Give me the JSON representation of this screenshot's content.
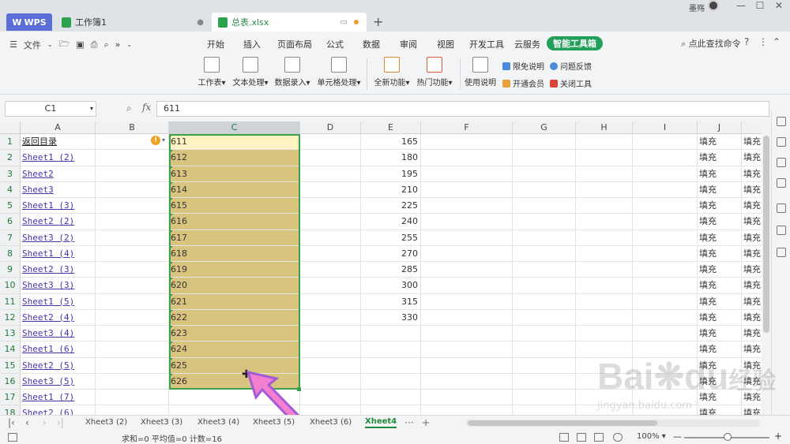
{
  "titlebar": {
    "tabs": [
      {
        "label": "WPS"
      },
      {
        "label": "工作簿1"
      },
      {
        "label": "总表.xlsx"
      }
    ],
    "user": "墨殇"
  },
  "menubar": {
    "file": "文件",
    "items": [
      "开始",
      "插入",
      "页面布局",
      "公式",
      "数据",
      "审阅",
      "视图",
      "开发工具",
      "云服务",
      "智能工具箱"
    ],
    "search": "点此查找命令"
  },
  "ribbon": {
    "buttons": [
      "工作表",
      "文本处理",
      "数据录入",
      "单元格处理",
      "全新功能",
      "热门功能",
      "使用说明"
    ],
    "small": [
      "限免说明",
      "问题反馈",
      "开通会员",
      "关闭工具"
    ]
  },
  "formula": {
    "namebox": "C1",
    "fx": "fx",
    "value": "611"
  },
  "grid": {
    "columns": [
      "A",
      "B",
      "C",
      "D",
      "E",
      "F",
      "G",
      "H",
      "I",
      "J"
    ],
    "rows": [
      "1",
      "2",
      "3",
      "4",
      "5",
      "6",
      "7",
      "8",
      "9",
      "10",
      "11",
      "12",
      "13",
      "14",
      "15",
      "16",
      "17",
      "18"
    ],
    "colA": [
      "返回目录",
      "Sheet1 (2)",
      "Sheet2",
      "Sheet3",
      "Sheet1 (3)",
      "Sheet2 (2)",
      "Sheet3 (2)",
      "Sheet1 (4)",
      "Sheet2 (3)",
      "Sheet3 (3)",
      "Sheet1 (5)",
      "Sheet2 (4)",
      "Sheet3 (4)",
      "Sheet1 (6)",
      "Sheet2 (5)",
      "Sheet3 (5)",
      "Sheet1 (7)",
      "Sheet2 (6)"
    ],
    "colC": [
      "611",
      "612",
      "613",
      "614",
      "615",
      "616",
      "617",
      "618",
      "619",
      "620",
      "621",
      "622",
      "623",
      "624",
      "625",
      "626"
    ],
    "colE": [
      "165",
      "180",
      "195",
      "210",
      "225",
      "240",
      "255",
      "270",
      "285",
      "300",
      "315",
      "330"
    ],
    "colJ": "填充",
    "colK": "填充"
  },
  "sheets": {
    "tabs": [
      "Xheet3 (2)",
      "Xheet3 (3)",
      "Xheet3 (4)",
      "Xheet3 (5)",
      "Xheet3 (6)",
      "Xheet4"
    ],
    "active": "Xheet4"
  },
  "status": {
    "summary": "求和=0  平均值=0  计数=16",
    "zoom": "100%"
  },
  "watermark": {
    "brand": "Bai",
    "brand2": "du",
    "sub": "经验",
    "url": "jingyan.baidu.com"
  },
  "colors": {
    "accent": "#22a05a",
    "selection": "#d9c47f",
    "link": "#4b32a8"
  }
}
